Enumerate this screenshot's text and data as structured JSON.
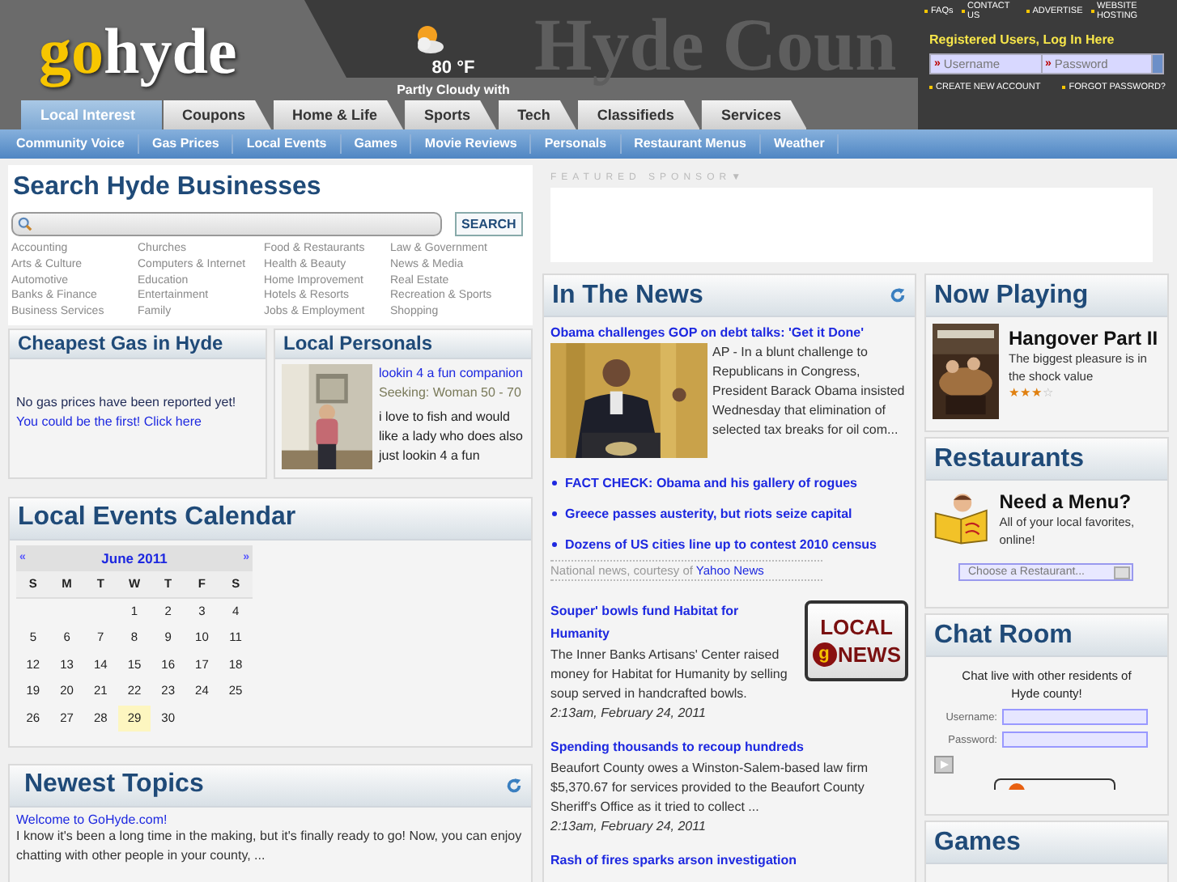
{
  "header": {
    "logo": {
      "accent": "go",
      "rest": "hyde"
    },
    "banner_text": "Hyde Coun",
    "weather": {
      "temperature": "80 °F",
      "condition": "Partly Cloudy with"
    },
    "top_links": [
      "FAQs",
      "CONTACT US",
      "ADVERTISE",
      "WEBSITE HOSTING"
    ],
    "login": {
      "title": "Registered Users, Log In Here",
      "fields": [
        {
          "marker": "»",
          "placeholder": "Username"
        },
        {
          "marker": "»",
          "placeholder": "Password"
        }
      ],
      "links": [
        "CREATE NEW ACCOUNT",
        "FORGOT PASSWORD?"
      ]
    }
  },
  "tabs": [
    {
      "label": "Local Interest",
      "selected": true
    },
    {
      "label": "Coupons",
      "selected": false
    },
    {
      "label": "Home & Life",
      "selected": false
    },
    {
      "label": "Sports",
      "selected": false
    },
    {
      "label": "Tech",
      "selected": false
    },
    {
      "label": "Classifieds",
      "selected": false
    },
    {
      "label": "Services",
      "selected": false
    }
  ],
  "subnav": [
    "Community Voice",
    "Gas Prices",
    "Local Events",
    "Games",
    "Movie Reviews",
    "Personals",
    "Restaurant Menus",
    "Weather"
  ],
  "search": {
    "title": "Search Hyde Businesses",
    "button": "SEARCH",
    "categories": [
      "Accounting",
      "Arts & Culture",
      "Automotive",
      "Banks & Finance",
      "Business Services",
      "Churches",
      "Computers & Internet",
      "Education",
      "Entertainment",
      "Family",
      "Food & Restaurants",
      "Health & Beauty",
      "Home Improvement",
      "Hotels & Resorts",
      "Jobs & Employment",
      "Law & Government",
      "News & Media",
      "Real Estate",
      "Recreation & Sports",
      "Shopping"
    ]
  },
  "gas": {
    "title": "Cheapest Gas in Hyde",
    "message": "No gas prices have been reported yet!",
    "link": "You could be the first! Click here"
  },
  "personals": {
    "title": "Local Personals",
    "headline": "lookin 4 a fun companion",
    "seeking": "Seeking: Woman 50 - 70",
    "text": "i love to fish and would like a lady who does also just lookin 4 a fun"
  },
  "calendar": {
    "title": "Local Events Calendar",
    "prev": "«",
    "month": "June 2011",
    "next": "»",
    "weekdays": [
      "S",
      "M",
      "T",
      "W",
      "T",
      "F",
      "S"
    ],
    "weeks": [
      [
        {
          "kind": "blank"
        },
        {
          "kind": "blank"
        },
        {
          "kind": "blank"
        },
        {
          "day": "1",
          "selected": false
        },
        {
          "day": "2",
          "selected": false
        },
        {
          "day": "3",
          "selected": false
        },
        {
          "day": "4",
          "selected": false
        }
      ],
      [
        {
          "day": "5",
          "selected": false
        },
        {
          "day": "6",
          "selected": false
        },
        {
          "day": "7",
          "selected": false
        },
        {
          "day": "8",
          "selected": false
        },
        {
          "day": "9",
          "selected": false
        },
        {
          "day": "10",
          "selected": false
        },
        {
          "day": "11",
          "selected": false
        }
      ],
      [
        {
          "day": "12",
          "selected": false
        },
        {
          "day": "13",
          "selected": false
        },
        {
          "day": "14",
          "selected": false
        },
        {
          "day": "15",
          "selected": false
        },
        {
          "day": "16",
          "selected": false
        },
        {
          "day": "17",
          "selected": false
        },
        {
          "day": "18",
          "selected": false
        }
      ],
      [
        {
          "day": "19",
          "selected": false
        },
        {
          "day": "20",
          "selected": false
        },
        {
          "day": "21",
          "selected": false
        },
        {
          "day": "22",
          "selected": false
        },
        {
          "day": "23",
          "selected": false
        },
        {
          "day": "24",
          "selected": false
        },
        {
          "day": "25",
          "selected": false
        }
      ],
      [
        {
          "day": "26",
          "selected": false
        },
        {
          "day": "27",
          "selected": false
        },
        {
          "day": "28",
          "selected": false
        },
        {
          "day": "29",
          "selected": true
        },
        {
          "day": "30",
          "selected": false
        }
      ]
    ]
  },
  "topics": {
    "title": "Newest Topics",
    "items": [
      {
        "title": "Welcome to GoHyde.com!",
        "excerpt": "I know it's been a long time in the making, but it's finally ready to go! Now, you can enjoy chatting with other people in your county, ..."
      }
    ]
  },
  "sponsor": {
    "label": "FEATURED SPONSOR▼"
  },
  "news": {
    "title": "In The News",
    "lead": {
      "title": "Obama challenges GOP on debt talks: 'Get it Done'",
      "text": "AP - In a blunt challenge to Republicans in Congress, President Barack Obama insisted Wednesday that elimination of selected tax breaks for oil com..."
    },
    "headlines": [
      "FACT CHECK: Obama and his gallery of rogues",
      "Greece passes austerity, but riots seize capital",
      "Dozens of US cities line up to contest 2010 census"
    ],
    "credit": "National news, courtesy of",
    "credit_link": "Yahoo News",
    "logo": {
      "top": "LOCAL",
      "badge": "g",
      "bottom": "NEWS"
    },
    "local": [
      {
        "title": "Souper' bowls fund Habitat for Humanity",
        "text": "The Inner Banks Artisans' Center raised money for Habitat for Humanity by selling soup served in handcrafted bowls.",
        "time": "2:13am, February 24, 2011"
      },
      {
        "title": "Spending thousands to recoup hundreds",
        "text": "Beaufort County owes a Winston-Salem-based law firm $5,370.67 for services provided to the Beaufort County Sheriff's Office as it tried to collect ...",
        "time": "2:13am, February 24, 2011"
      },
      {
        "title": "Rash of fires sparks arson investigation"
      }
    ]
  },
  "now_playing": {
    "title": "Now Playing",
    "movie": "Hangover Part II",
    "blurb": "The biggest pleasure is in the shock value",
    "stars": 3
  },
  "restaurants": {
    "title": "Restaurants",
    "heading": "Need a Menu?",
    "text": "All of your local favorites, online!",
    "select": "Choose a Restaurant..."
  },
  "chat": {
    "title": "Chat Room",
    "text": "Chat live with other residents of Hyde county!",
    "username_label": "Username:",
    "password_label": "Password:"
  },
  "games": {
    "title": "Games"
  }
}
